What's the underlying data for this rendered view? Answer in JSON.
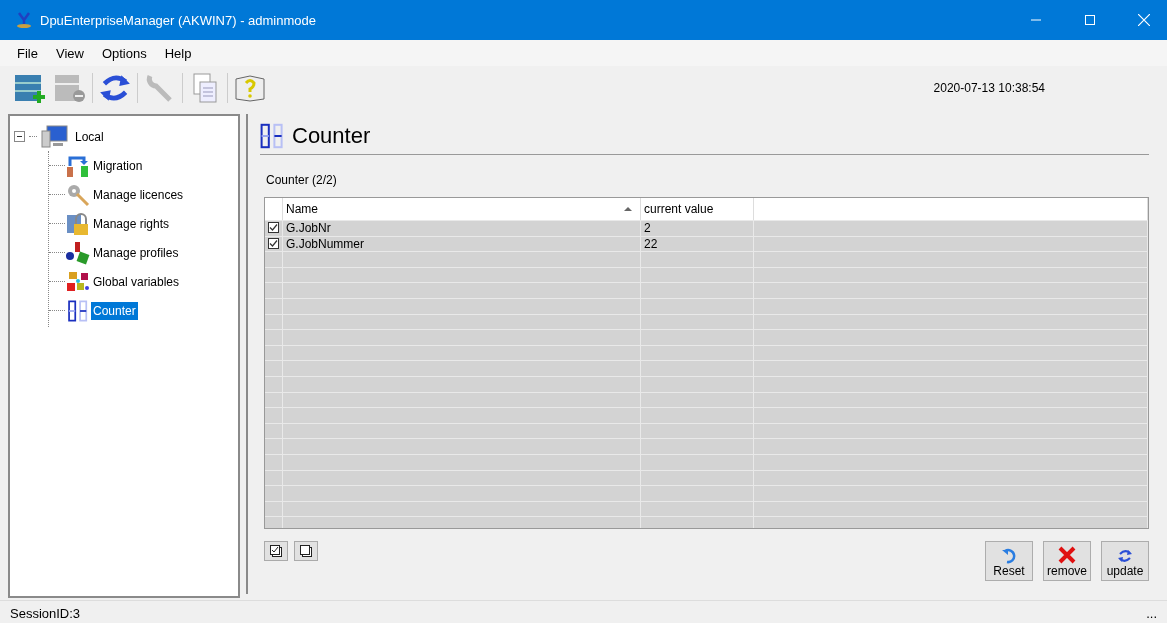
{
  "window": {
    "title": "DpuEnterpriseManager (AKWIN7) - adminmode"
  },
  "menu": [
    "File",
    "View",
    "Options",
    "Help"
  ],
  "toolbar": {
    "timestamp": "2020-07-13 10:38:54"
  },
  "tree": {
    "label": "Local",
    "expanded": true,
    "children": [
      {
        "label": "Migration",
        "selected": false
      },
      {
        "label": "Manage licences",
        "selected": false
      },
      {
        "label": "Manage rights",
        "selected": false
      },
      {
        "label": "Manage profiles",
        "selected": false
      },
      {
        "label": "Global variables",
        "selected": false
      },
      {
        "label": "Counter",
        "selected": true
      }
    ]
  },
  "panel": {
    "title": "Counter",
    "subtitle": "Counter (2/2)"
  },
  "table": {
    "columns": [
      "Name",
      "current value"
    ],
    "rows": [
      {
        "checked": true,
        "name": "G.JobNr",
        "value": "2"
      },
      {
        "checked": true,
        "name": "G.JobNummer",
        "value": "22"
      }
    ]
  },
  "buttons": [
    "Reset",
    "remove",
    "update"
  ],
  "status_bar": {
    "session": "SessionID:3",
    "extra": "..."
  }
}
